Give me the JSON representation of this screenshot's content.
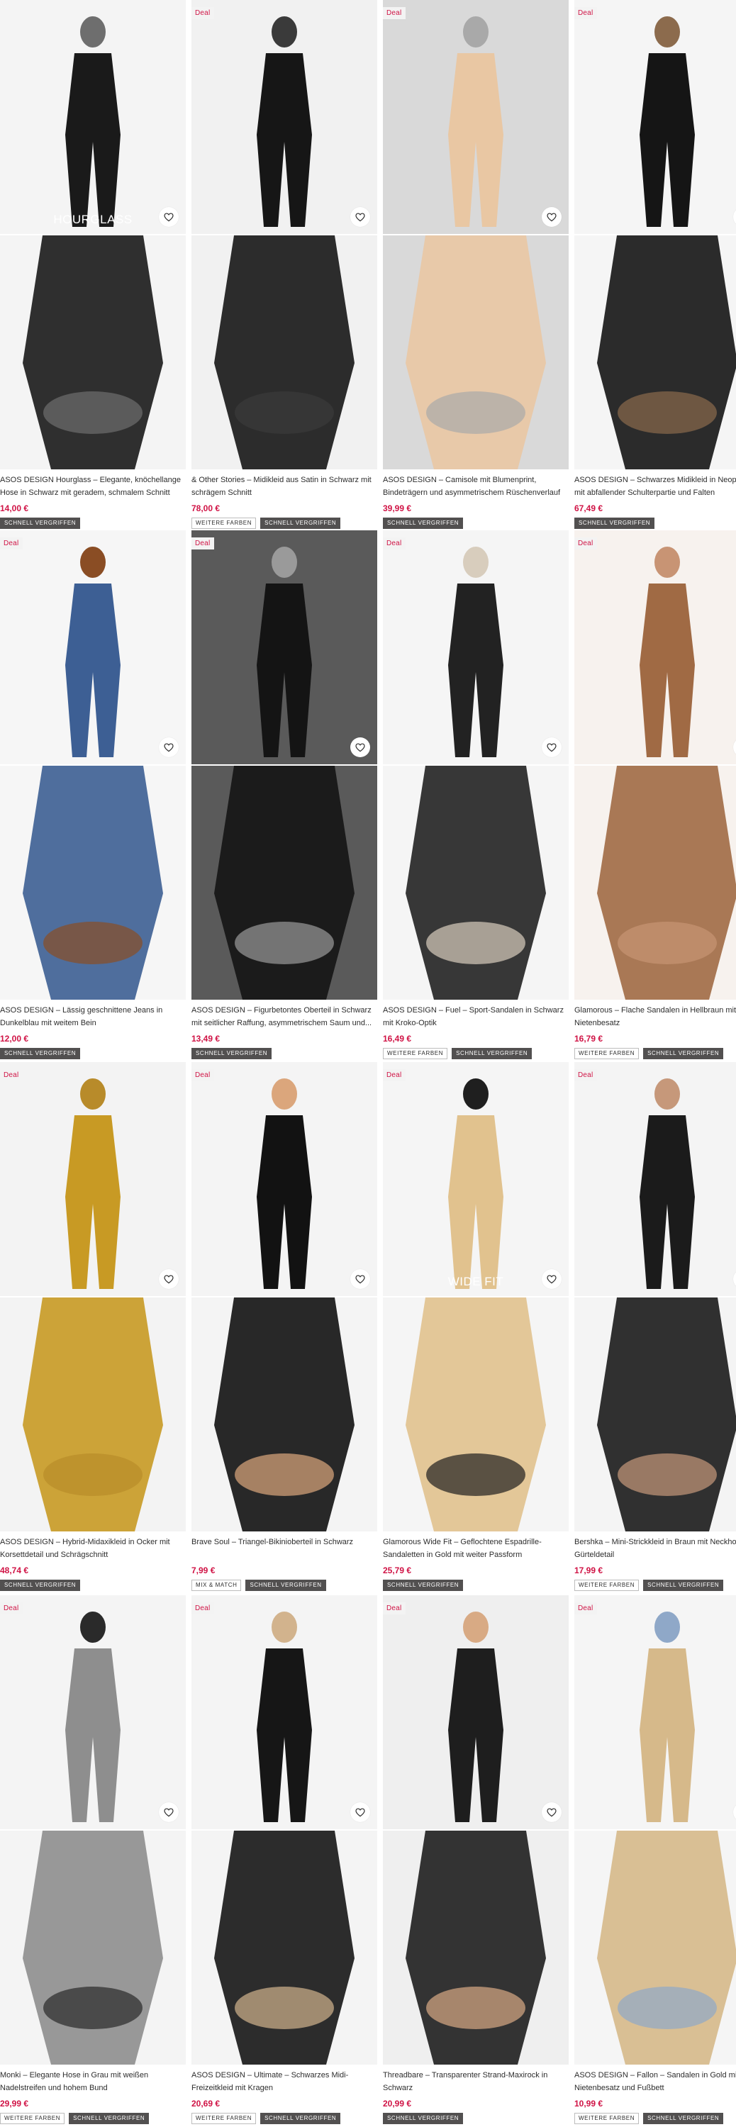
{
  "labels": {
    "deal": "Deal",
    "hourglass": "HOURGLASS",
    "wide_fit": "WIDE FIT"
  },
  "badges": {
    "weitere_farben": "WEITERE FARBEN",
    "schnell_vergriffen": "SCHNELL VERGRIFFEN",
    "mix_match": "MIX & MATCH"
  },
  "icons": {
    "wishlist": "heart-outline-icon"
  },
  "colors": {
    "price": "#d01345",
    "badge_dark": "#525050",
    "deal_bg": "#f3f3f3"
  },
  "products": [
    {
      "title": "ASOS DESIGN Hourglass – Elegante, knöchellange Hose in Schwarz mit geradem, schmalem Schnitt",
      "price": "14,00 €",
      "tags": [
        "SCHNELL VERGRIFFEN"
      ],
      "deal": false,
      "overlay": "HOURGLASS"
    },
    {
      "title": "& Other Stories – Midikleid aus Satin in Schwarz mit schrägem Schnitt",
      "price": "78,00 €",
      "tags": [
        "WEITERE FARBEN",
        "SCHNELL VERGRIFFEN"
      ],
      "deal": true,
      "overlay": ""
    },
    {
      "title": "ASOS DESIGN – Camisole mit Blumenprint, Bindeträgern und asymmetrischem Rüschenverlauf",
      "price": "39,99 €",
      "tags": [
        "SCHNELL VERGRIFFEN"
      ],
      "deal": true,
      "overlay": ""
    },
    {
      "title": "ASOS DESIGN – Schwarzes Midikleid in Neop Optik mit abfallender Schulterpartie und Falten",
      "price": "67,49 €",
      "tags": [
        "SCHNELL VERGRIFFEN"
      ],
      "deal": true,
      "overlay": ""
    },
    {
      "title": "ASOS DESIGN – Lässig geschnittene Jeans in Dunkelblau mit weitem Bein",
      "price": "12,00 €",
      "tags": [
        "SCHNELL VERGRIFFEN"
      ],
      "deal": true,
      "overlay": ""
    },
    {
      "title": "ASOS DESIGN – Figurbetontes Oberteil in Schwarz mit seitlicher Raffung, asymmetrischem Saum und...",
      "price": "13,49 €",
      "tags": [
        "SCHNELL VERGRIFFEN"
      ],
      "deal": true,
      "overlay": ""
    },
    {
      "title": "ASOS DESIGN – Fuel – Sport-Sandalen in Schwarz mit Kroko-Optik",
      "price": "16,49 €",
      "tags": [
        "WEITERE FARBEN",
        "SCHNELL VERGRIFFEN"
      ],
      "deal": true,
      "overlay": ""
    },
    {
      "title": "Glamorous – Flache Sandalen in Hellbraun mit Nietenbesatz",
      "price": "16,79 €",
      "tags": [
        "WEITERE FARBEN",
        "SCHNELL VERGRIFFEN"
      ],
      "deal": true,
      "overlay": ""
    },
    {
      "title": "ASOS DESIGN – Hybrid-Midaxikleid in Ocker mit Korsettdetail und Schrägschnitt",
      "price": "48,74 €",
      "tags": [
        "SCHNELL VERGRIFFEN"
      ],
      "deal": true,
      "overlay": ""
    },
    {
      "title": "Brave Soul – Triangel-Bikinioberteil in Schwarz",
      "price": "7,99 €",
      "tags": [
        "MIX & MATCH",
        "SCHNELL VERGRIFFEN"
      ],
      "deal": true,
      "overlay": ""
    },
    {
      "title": "Glamorous Wide Fit – Geflochtene Espadrille-Sandaletten in Gold mit weiter Passform",
      "price": "25,79 €",
      "tags": [
        "SCHNELL VERGRIFFEN"
      ],
      "deal": true,
      "overlay": "WIDE FIT"
    },
    {
      "title": "Bershka – Mini-Strickkleid in Braun mit Neckho und Gürteldetail",
      "price": "17,99 €",
      "tags": [
        "WEITERE FARBEN",
        "SCHNELL VERGRIFFEN"
      ],
      "deal": true,
      "overlay": ""
    },
    {
      "title": "Monki – Elegante Hose in Grau mit weißen Nadelstreifen und hohem Bund",
      "price": "29,99 €",
      "tags": [
        "WEITERE FARBEN",
        "SCHNELL VERGRIFFEN"
      ],
      "deal": true,
      "overlay": ""
    },
    {
      "title": "ASOS DESIGN – Ultimate – Schwarzes Midi-Freizeitkleid mit Kragen",
      "price": "20,69 €",
      "tags": [
        "WEITERE FARBEN",
        "SCHNELL VERGRIFFEN"
      ],
      "deal": true,
      "overlay": ""
    },
    {
      "title": "Threadbare – Transparenter Strand-Maxirock in Schwarz",
      "price": "20,99 €",
      "tags": [
        "SCHNELL VERGRIFFEN"
      ],
      "deal": true,
      "overlay": ""
    },
    {
      "title": "ASOS DESIGN – Fallon – Sandalen in Gold mit Nietenbesatz und Fußbett",
      "price": "10,99 €",
      "tags": [
        "WEITERE FARBEN",
        "SCHNELL VERGRIFFEN"
      ],
      "deal": true,
      "overlay": ""
    }
  ]
}
